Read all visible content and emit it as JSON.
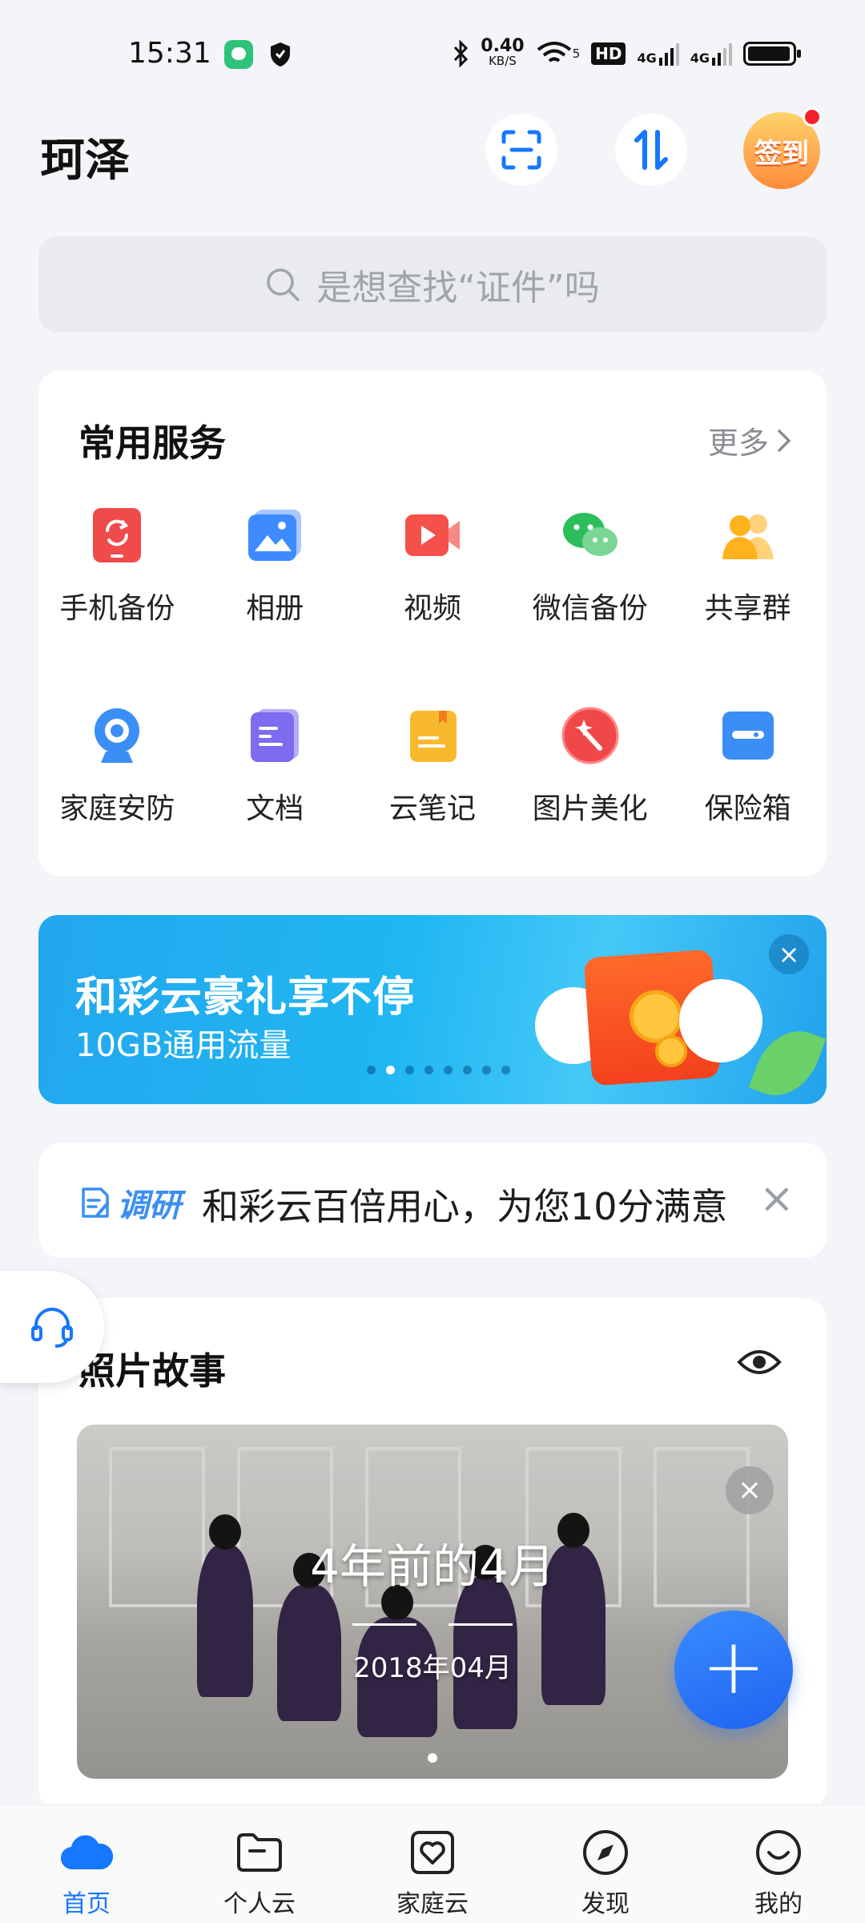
{
  "status_bar": {
    "time": "15:31",
    "network_speed_value": "0.40",
    "network_speed_unit": "KB/S",
    "wifi_badge": "5",
    "hd_badge": "HD",
    "signal_1": "4G",
    "signal_2": "4G"
  },
  "header": {
    "title": "珂泽",
    "signin_label": "签到"
  },
  "search": {
    "placeholder": "是想查找“证件”吗"
  },
  "services": {
    "title": "常用服务",
    "more_label": "更多",
    "items": [
      {
        "label": "手机备份",
        "icon": "phone-backup-icon",
        "color": "#f04b4b"
      },
      {
        "label": "相册",
        "icon": "album-icon",
        "color": "#3d8bff"
      },
      {
        "label": "视频",
        "icon": "video-icon",
        "color": "#f5504a"
      },
      {
        "label": "微信备份",
        "icon": "wechat-icon",
        "color": "#2bbf5b"
      },
      {
        "label": "共享群",
        "icon": "share-group-icon",
        "color": "#ffb21c"
      },
      {
        "label": "家庭安防",
        "icon": "camera-icon",
        "color": "#3a8ef6"
      },
      {
        "label": "文档",
        "icon": "document-icon",
        "color": "#7b6cf0"
      },
      {
        "label": "云笔记",
        "icon": "note-icon",
        "color": "#f9b92f"
      },
      {
        "label": "图片美化",
        "icon": "photo-beautify-icon",
        "color": "#f04848"
      },
      {
        "label": "保险箱",
        "icon": "safe-icon",
        "color": "#3a8ef6"
      }
    ]
  },
  "banner": {
    "title": "和彩云豪礼享不停",
    "subtitle": "10GB通用流量",
    "dot_count": 8,
    "active_dot": 1
  },
  "survey": {
    "tag": "调研",
    "text": "和彩云百倍用心，为您10分满意"
  },
  "photo_story": {
    "title": "照片故事",
    "photo_title": "4年前的4月",
    "photo_date": "2018年04月"
  },
  "bottom_nav": {
    "items": [
      {
        "label": "首页",
        "active": true
      },
      {
        "label": "个人云",
        "active": false
      },
      {
        "label": "家庭云",
        "active": false
      },
      {
        "label": "发现",
        "active": false
      },
      {
        "label": "我的",
        "active": false
      }
    ]
  },
  "colors": {
    "accent": "#1677ff",
    "background": "#f3f5f8"
  }
}
